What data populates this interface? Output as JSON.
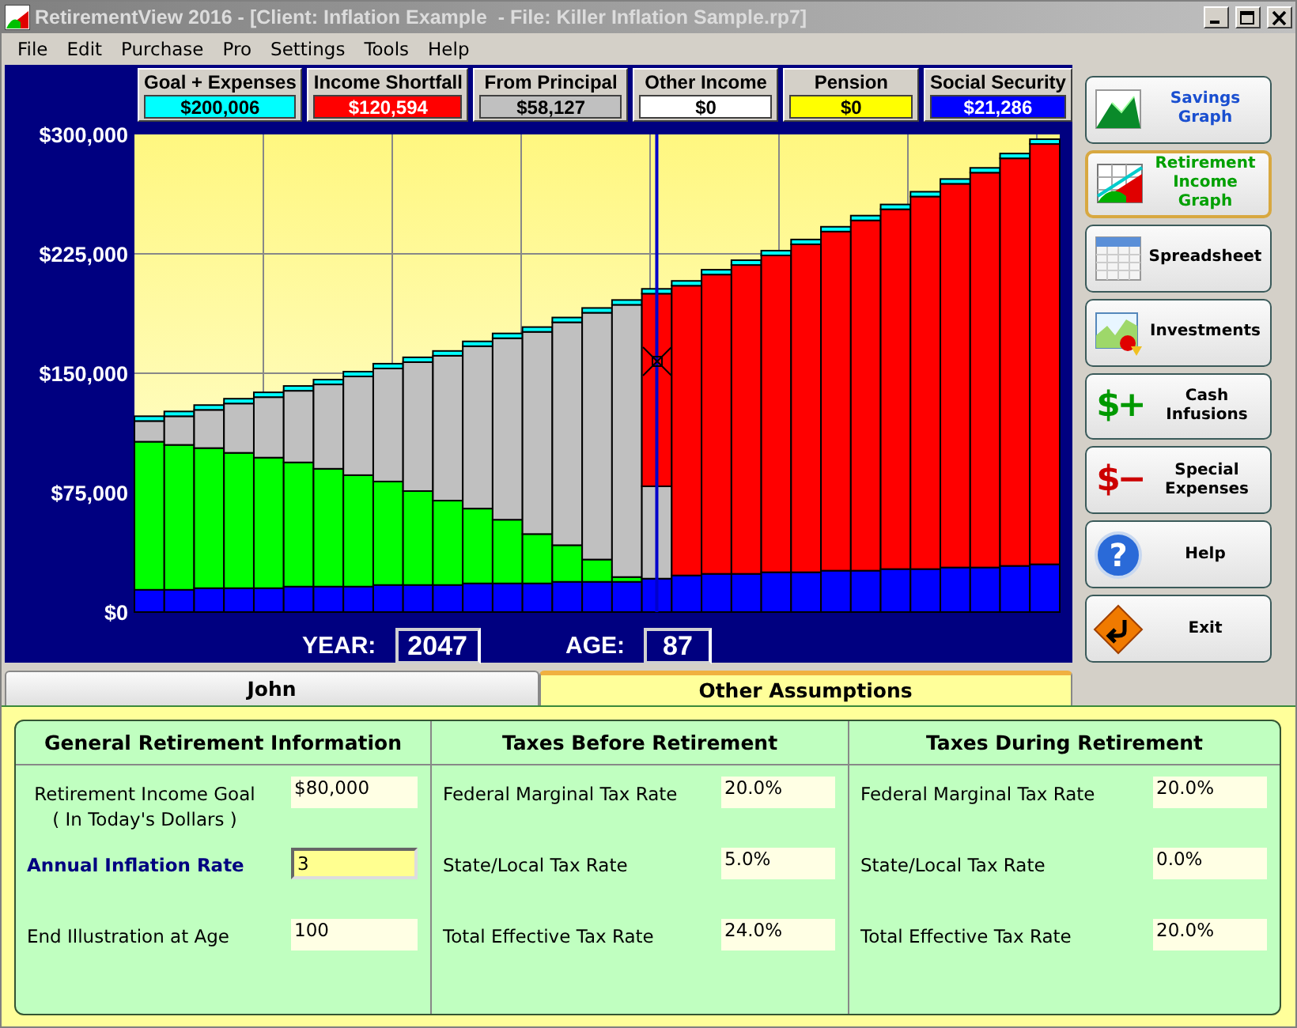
{
  "window": {
    "title": "RetirementView 2016 - [Client: Inflation Example  - File: Killer Inflation Sample.rp7]"
  },
  "menu": [
    "File",
    "Edit",
    "Purchase",
    "Pro",
    "Settings",
    "Tools",
    "Help"
  ],
  "chart": {
    "legend_values": [
      "$200,006",
      "$120,594",
      "$58,127",
      "$0",
      "$0",
      "$21,286"
    ],
    "chart_data": {
      "type": "bar",
      "stacked": true,
      "grid": true,
      "yticks": [
        {
          "value": 0,
          "label": "$0"
        },
        {
          "value": 75000,
          "label": "$75,000"
        },
        {
          "value": 150000,
          "label": "$150,000"
        },
        {
          "value": 225000,
          "label": "$225,000"
        },
        {
          "value": 300000,
          "label": "$300,000"
        }
      ],
      "ylim": [
        0,
        300000
      ],
      "series": [
        {
          "name": "Social Security",
          "color": "#0000ff",
          "values": [
            14000,
            14000,
            15000,
            15000,
            15000,
            16000,
            16000,
            16000,
            17000,
            17000,
            17000,
            18000,
            18000,
            18000,
            19000,
            19000,
            19000,
            21000,
            23000,
            24000,
            24000,
            25000,
            25000,
            26000,
            26000,
            27000,
            27000,
            28000,
            28000,
            29000,
            30000
          ]
        },
        {
          "name": "Pension",
          "color": "#ffff00",
          "values": [
            0,
            0,
            0,
            0,
            0,
            0,
            0,
            0,
            0,
            0,
            0,
            0,
            0,
            0,
            0,
            0,
            0,
            0,
            0,
            0,
            0,
            0,
            0,
            0,
            0,
            0,
            0,
            0,
            0,
            0,
            0
          ]
        },
        {
          "name": "Other Income",
          "color": "#ffffff",
          "values": [
            0,
            0,
            0,
            0,
            0,
            0,
            0,
            0,
            0,
            0,
            0,
            0,
            0,
            0,
            0,
            0,
            0,
            0,
            0,
            0,
            0,
            0,
            0,
            0,
            0,
            0,
            0,
            0,
            0,
            0,
            0
          ]
        },
        {
          "color": "#00ff00",
          "values": [
            93000,
            91000,
            88000,
            85000,
            82000,
            78000,
            74000,
            70000,
            65000,
            59000,
            53000,
            47000,
            40000,
            31000,
            23000,
            14000,
            3000,
            0,
            0,
            0,
            0,
            0,
            0,
            0,
            0,
            0,
            0,
            0,
            0,
            0,
            0
          ]
        },
        {
          "name": "From Principal",
          "color": "#c0c0c0",
          "values": [
            13000,
            18000,
            24000,
            31000,
            38000,
            45000,
            53000,
            62000,
            71000,
            81000,
            91000,
            102000,
            114000,
            127000,
            140000,
            155000,
            171000,
            58000,
            0,
            0,
            0,
            0,
            0,
            0,
            0,
            0,
            0,
            0,
            0,
            0,
            0
          ]
        },
        {
          "name": "Income Shortfall",
          "color": "#ff0000",
          "values": [
            0,
            0,
            0,
            0,
            0,
            0,
            0,
            0,
            0,
            0,
            0,
            0,
            0,
            0,
            0,
            0,
            0,
            121000,
            182000,
            188000,
            194000,
            199000,
            206000,
            213000,
            220000,
            226000,
            234000,
            241000,
            248000,
            256000,
            264000
          ]
        },
        {
          "name": "Goal + Expenses",
          "color": "#00ffff",
          "values": [
            3000,
            3000,
            3000,
            3000,
            3000,
            3000,
            3000,
            3000,
            3000,
            3000,
            3000,
            3000,
            3000,
            3000,
            3000,
            3000,
            3000,
            3000,
            3000,
            3000,
            3000,
            3000,
            3000,
            3000,
            3000,
            3000,
            3000,
            3000,
            3000,
            3000,
            3000
          ]
        }
      ]
    },
    "readout": {
      "year_label": "YEAR:",
      "year": "2047",
      "age_label": "AGE:",
      "age": "87"
    }
  },
  "nav_buttons": [
    {
      "label": "Savings Graph",
      "kind": "savings",
      "color": "#1a4fd0",
      "selected": false
    },
    {
      "label": "Retirement Income Graph",
      "kind": "income",
      "color": "#00a000",
      "selected": true
    },
    {
      "label": "Spreadsheet",
      "kind": "spreadsheet",
      "color": "#000000",
      "selected": false
    },
    {
      "label": "Investments",
      "kind": "investments",
      "color": "#000000",
      "selected": false
    },
    {
      "label": "Cash Infusions",
      "kind": "cash-in",
      "icon": "$+",
      "color": "#000000",
      "selected": false
    },
    {
      "label": "Special Expenses",
      "kind": "cash-out",
      "icon": "$−",
      "color": "#000000",
      "selected": false
    },
    {
      "label": "Help",
      "kind": "help",
      "icon": "?",
      "color": "#000000",
      "selected": false
    },
    {
      "label": "Exit",
      "kind": "exit",
      "color": "#000000",
      "selected": false
    }
  ],
  "assumptions": {
    "tabs": [
      {
        "label": "John",
        "selected": false
      },
      {
        "label": "Other Assumptions",
        "selected": true
      }
    ],
    "sections": [
      {
        "title": "General Retirement Information",
        "fields": [
          {
            "label": "Retirement Income Goal",
            "note": "( In Today's Dollars )",
            "value": "$80,000",
            "focused": false
          },
          {
            "label": "Annual Inflation Rate",
            "value": "3",
            "focused": true
          },
          {
            "label": "End Illustration at Age",
            "value": "100",
            "focused": false
          }
        ]
      },
      {
        "title": "Taxes Before Retirement",
        "fields": [
          {
            "label": "Federal Marginal Tax Rate",
            "value": "20.0%",
            "focused": false
          },
          {
            "label": "State/Local Tax Rate",
            "value": "5.0%",
            "focused": false
          },
          {
            "label": "Total Effective Tax Rate",
            "value": "24.0%",
            "focused": false
          }
        ]
      },
      {
        "title": "Taxes During Retirement",
        "fields": [
          {
            "label": "Federal Marginal Tax Rate",
            "value": "20.0%",
            "focused": false
          },
          {
            "label": "State/Local Tax Rate",
            "value": "0.0%",
            "focused": false
          },
          {
            "label": "Total Effective Tax Rate",
            "value": "20.0%",
            "focused": false
          }
        ]
      }
    ]
  }
}
